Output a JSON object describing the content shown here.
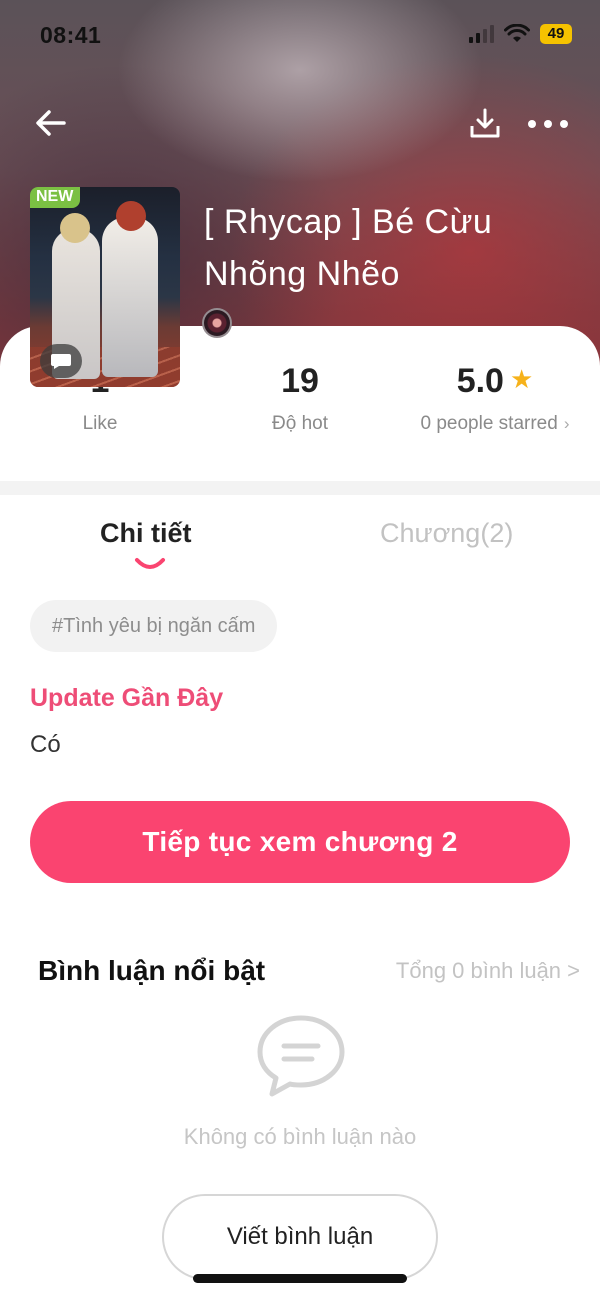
{
  "status_bar": {
    "time": "08:41",
    "battery": "49"
  },
  "header": {
    "back_icon": "arrow-left-icon",
    "download_icon": "download-icon",
    "more_icon": "more-dots-icon"
  },
  "story": {
    "badge": "NEW",
    "title": "[ Rhycap ] Bé Cừu Nhõng Nhẽo"
  },
  "stats": {
    "like_value": "1",
    "like_label": "Like",
    "hot_value": "19",
    "hot_label": "Độ hot",
    "rating_value": "5.0",
    "rating_label": "0 people starred"
  },
  "tabs": [
    {
      "label": "Chi tiết",
      "active": true
    },
    {
      "label": "Chương(2)",
      "active": false
    }
  ],
  "tag": "#Tình yêu bị ngăn cấm",
  "update": {
    "title": "Update Gần Đây",
    "value": "Có"
  },
  "continue_button": "Tiếp tục xem chương 2",
  "comments": {
    "title": "Bình luận nổi bật",
    "total": "Tổng 0 bình luận >",
    "empty": "Không có bình luận nào",
    "write_button": "Viết bình luận"
  },
  "colors": {
    "accent": "#fa4470",
    "accent_text": "#ee4d77",
    "star": "#f6b21b",
    "new_badge": "#7bc043"
  }
}
